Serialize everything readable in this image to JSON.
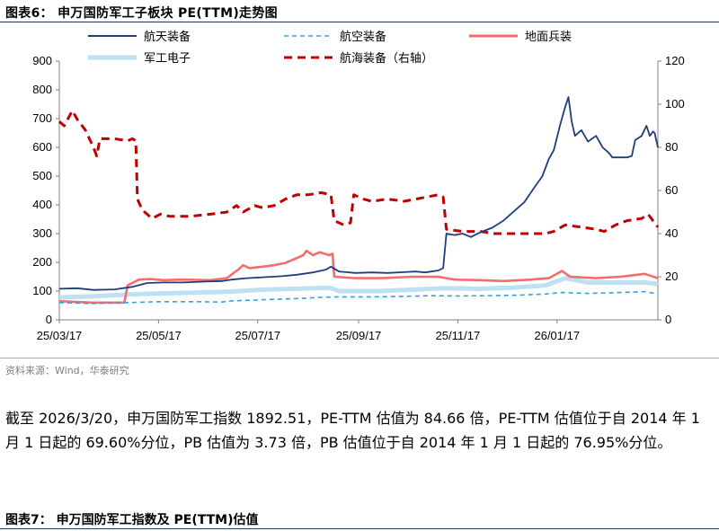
{
  "figure6": {
    "title": "图表6：   申万国防军工子板块 PE(TTM)走势图",
    "source": "资料来源：Wind，华泰研究"
  },
  "paragraph": "截至 2026/3/20，申万国防军工指数 1892.51，PE-TTM 估值为 84.66 倍，PE-TTM 估值位于自 2014 年 1 月 1 日起的 69.60%分位，PB 估值为 3.73 倍，PB 估值位于自 2014 年 1 月 1 日起的 76.95%分位。",
  "figure7": {
    "title": "图表7：   申万国防军工指数及 PE(TTM)估值"
  },
  "chart_data": {
    "type": "line",
    "title": "",
    "x_tick_labels": [
      "25/03/17",
      "25/05/17",
      "25/07/17",
      "25/09/17",
      "25/11/17",
      "26/01/17"
    ],
    "x_range": [
      "2025-03-17",
      "2026-03-20"
    ],
    "y_left": {
      "min": 0,
      "max": 900,
      "ticks": [
        0,
        100,
        200,
        300,
        400,
        500,
        600,
        700,
        800,
        900
      ]
    },
    "y_right": {
      "min": 0,
      "max": 120,
      "ticks": [
        0,
        20,
        40,
        60,
        80,
        100,
        120
      ]
    },
    "grid": false,
    "legend_position": "top",
    "series": [
      {
        "name": "航天装备",
        "axis": "left",
        "color": "#1f3d7a",
        "style": "solid",
        "points": [
          [
            "2025-03-17",
            108
          ],
          [
            "2025-03-28",
            110
          ],
          [
            "2025-04-07",
            104
          ],
          [
            "2025-04-20",
            106
          ],
          [
            "2025-05-01",
            115
          ],
          [
            "2025-05-10",
            128
          ],
          [
            "2025-05-20",
            130
          ],
          [
            "2025-06-01",
            130
          ],
          [
            "2025-06-15",
            133
          ],
          [
            "2025-06-25",
            135
          ],
          [
            "2025-07-01",
            140
          ],
          [
            "2025-07-10",
            145
          ],
          [
            "2025-07-20",
            148
          ],
          [
            "2025-08-01",
            152
          ],
          [
            "2025-08-10",
            157
          ],
          [
            "2025-08-20",
            165
          ],
          [
            "2025-08-28",
            175
          ],
          [
            "2025-08-31",
            185
          ],
          [
            "2025-09-05",
            168
          ],
          [
            "2025-09-15",
            163
          ],
          [
            "2025-09-25",
            165
          ],
          [
            "2025-10-05",
            163
          ],
          [
            "2025-10-15",
            166
          ],
          [
            "2025-10-22",
            168
          ],
          [
            "2025-10-28",
            165
          ],
          [
            "2025-11-05",
            172
          ],
          [
            "2025-11-08",
            180
          ],
          [
            "2025-11-10",
            300
          ],
          [
            "2025-11-15",
            295
          ],
          [
            "2025-11-20",
            300
          ],
          [
            "2025-11-25",
            288
          ],
          [
            "2025-12-01",
            305
          ],
          [
            "2025-12-08",
            320
          ],
          [
            "2025-12-15",
            345
          ],
          [
            "2025-12-22",
            380
          ],
          [
            "2025-12-28",
            410
          ],
          [
            "2026-01-03",
            460
          ],
          [
            "2026-01-08",
            500
          ],
          [
            "2026-01-12",
            560
          ],
          [
            "2026-01-15",
            590
          ],
          [
            "2026-01-19",
            680
          ],
          [
            "2026-01-22",
            740
          ],
          [
            "2026-01-24",
            775
          ],
          [
            "2026-01-26",
            690
          ],
          [
            "2026-01-28",
            640
          ],
          [
            "2026-02-01",
            660
          ],
          [
            "2026-02-05",
            620
          ],
          [
            "2026-02-10",
            640
          ],
          [
            "2026-02-14",
            600
          ],
          [
            "2026-02-18",
            580
          ],
          [
            "2026-02-20",
            565
          ],
          [
            "2026-03-01",
            565
          ],
          [
            "2026-03-04",
            570
          ],
          [
            "2026-03-06",
            625
          ],
          [
            "2026-03-10",
            640
          ],
          [
            "2026-03-13",
            675
          ],
          [
            "2026-03-15",
            640
          ],
          [
            "2026-03-17",
            655
          ],
          [
            "2026-03-18",
            650
          ],
          [
            "2026-03-20",
            600
          ]
        ]
      },
      {
        "name": "航空装备",
        "axis": "left",
        "color": "#33a3dc",
        "style": "dashed",
        "points": [
          [
            "2025-03-17",
            60
          ],
          [
            "2025-04-07",
            57
          ],
          [
            "2025-04-28",
            60
          ],
          [
            "2025-05-17",
            63
          ],
          [
            "2025-06-10",
            63
          ],
          [
            "2025-06-25",
            62
          ],
          [
            "2025-07-01",
            66
          ],
          [
            "2025-07-20",
            70
          ],
          [
            "2025-08-10",
            74
          ],
          [
            "2025-08-25",
            78
          ],
          [
            "2025-09-05",
            80
          ],
          [
            "2025-09-25",
            80
          ],
          [
            "2025-10-15",
            82
          ],
          [
            "2025-11-01",
            84
          ],
          [
            "2025-11-17",
            83
          ],
          [
            "2025-12-05",
            84
          ],
          [
            "2025-12-25",
            86
          ],
          [
            "2026-01-10",
            90
          ],
          [
            "2026-01-20",
            95
          ],
          [
            "2026-02-05",
            92
          ],
          [
            "2026-02-25",
            95
          ],
          [
            "2026-03-12",
            98
          ],
          [
            "2026-03-20",
            90
          ]
        ]
      },
      {
        "name": "地面兵装",
        "axis": "left",
        "color": "#f26d6d",
        "style": "solid",
        "points": [
          [
            "2025-03-17",
            65
          ],
          [
            "2025-04-06",
            60
          ],
          [
            "2025-04-26",
            60
          ],
          [
            "2025-04-28",
            120
          ],
          [
            "2025-05-05",
            140
          ],
          [
            "2025-05-12",
            142
          ],
          [
            "2025-05-20",
            138
          ],
          [
            "2025-06-01",
            140
          ],
          [
            "2025-06-18",
            138
          ],
          [
            "2025-06-28",
            145
          ],
          [
            "2025-07-05",
            175
          ],
          [
            "2025-07-08",
            190
          ],
          [
            "2025-07-12",
            180
          ],
          [
            "2025-07-20",
            185
          ],
          [
            "2025-07-27",
            190
          ],
          [
            "2025-08-03",
            198
          ],
          [
            "2025-08-08",
            210
          ],
          [
            "2025-08-14",
            225
          ],
          [
            "2025-08-16",
            240
          ],
          [
            "2025-08-20",
            225
          ],
          [
            "2025-08-24",
            235
          ],
          [
            "2025-08-30",
            225
          ],
          [
            "2025-09-01",
            230
          ],
          [
            "2025-09-02",
            150
          ],
          [
            "2025-09-15",
            145
          ],
          [
            "2025-10-01",
            145
          ],
          [
            "2025-10-20",
            150
          ],
          [
            "2025-11-05",
            150
          ],
          [
            "2025-11-15",
            140
          ],
          [
            "2025-12-01",
            138
          ],
          [
            "2025-12-15",
            135
          ],
          [
            "2026-01-01",
            140
          ],
          [
            "2026-01-12",
            145
          ],
          [
            "2026-01-20",
            170
          ],
          [
            "2026-01-25",
            150
          ],
          [
            "2026-02-10",
            145
          ],
          [
            "2026-02-25",
            150
          ],
          [
            "2026-03-12",
            160
          ],
          [
            "2026-03-20",
            145
          ]
        ]
      },
      {
        "name": "军工电子",
        "axis": "left",
        "color": "#bde0f3",
        "style": "thick",
        "points": [
          [
            "2025-03-17",
            78
          ],
          [
            "2025-04-07",
            82
          ],
          [
            "2025-04-28",
            88
          ],
          [
            "2025-05-17",
            92
          ],
          [
            "2025-06-10",
            95
          ],
          [
            "2025-06-30",
            98
          ],
          [
            "2025-07-20",
            105
          ],
          [
            "2025-08-10",
            108
          ],
          [
            "2025-08-30",
            112
          ],
          [
            "2025-09-05",
            100
          ],
          [
            "2025-09-30",
            100
          ],
          [
            "2025-10-20",
            105
          ],
          [
            "2025-11-10",
            110
          ],
          [
            "2025-11-30",
            108
          ],
          [
            "2025-12-20",
            112
          ],
          [
            "2026-01-10",
            120
          ],
          [
            "2026-01-22",
            145
          ],
          [
            "2026-02-05",
            130
          ],
          [
            "2026-02-25",
            130
          ],
          [
            "2026-03-12",
            130
          ],
          [
            "2026-03-20",
            125
          ]
        ]
      },
      {
        "name": "航海装备（右轴）",
        "axis": "right",
        "color": "#c00000",
        "style": "dashed-bold",
        "points": [
          [
            "2025-03-17",
            92
          ],
          [
            "2025-03-20",
            90
          ],
          [
            "2025-03-25",
            97
          ],
          [
            "2025-03-28",
            93
          ],
          [
            "2025-04-02",
            88
          ],
          [
            "2025-04-07",
            80
          ],
          [
            "2025-04-09",
            76
          ],
          [
            "2025-04-11",
            84
          ],
          [
            "2025-04-20",
            84
          ],
          [
            "2025-04-28",
            83
          ],
          [
            "2025-05-01",
            84
          ],
          [
            "2025-05-03",
            83
          ],
          [
            "2025-05-04",
            56
          ],
          [
            "2025-05-07",
            51
          ],
          [
            "2025-05-10",
            49
          ],
          [
            "2025-05-13",
            47
          ],
          [
            "2025-05-18",
            49
          ],
          [
            "2025-05-24",
            48
          ],
          [
            "2025-06-05",
            48
          ],
          [
            "2025-06-18",
            49
          ],
          [
            "2025-06-28",
            50
          ],
          [
            "2025-07-04",
            53
          ],
          [
            "2025-07-08",
            50
          ],
          [
            "2025-07-15",
            53
          ],
          [
            "2025-07-20",
            52
          ],
          [
            "2025-07-27",
            53
          ],
          [
            "2025-08-03",
            56
          ],
          [
            "2025-08-10",
            58
          ],
          [
            "2025-08-17",
            58
          ],
          [
            "2025-08-25",
            59
          ],
          [
            "2025-08-31",
            58
          ],
          [
            "2025-09-02",
            46
          ],
          [
            "2025-09-08",
            44
          ],
          [
            "2025-09-12",
            45
          ],
          [
            "2025-09-14",
            58
          ],
          [
            "2025-09-20",
            56
          ],
          [
            "2025-09-25",
            55
          ],
          [
            "2025-10-05",
            56
          ],
          [
            "2025-10-15",
            55
          ],
          [
            "2025-10-22",
            56
          ],
          [
            "2025-11-05",
            58
          ],
          [
            "2025-11-08",
            57
          ],
          [
            "2025-11-10",
            42
          ],
          [
            "2025-11-20",
            41
          ],
          [
            "2025-12-01",
            41
          ],
          [
            "2025-12-10",
            40
          ],
          [
            "2025-12-20",
            40
          ],
          [
            "2026-01-01",
            40
          ],
          [
            "2026-01-10",
            40
          ],
          [
            "2026-01-15",
            41
          ],
          [
            "2026-01-22",
            44
          ],
          [
            "2026-02-01",
            43
          ],
          [
            "2026-02-10",
            42
          ],
          [
            "2026-02-15",
            41
          ],
          [
            "2026-02-22",
            44
          ],
          [
            "2026-03-01",
            46
          ],
          [
            "2026-03-10",
            47
          ],
          [
            "2026-03-14",
            49
          ],
          [
            "2026-03-17",
            46
          ],
          [
            "2026-03-20",
            43
          ]
        ]
      }
    ]
  }
}
